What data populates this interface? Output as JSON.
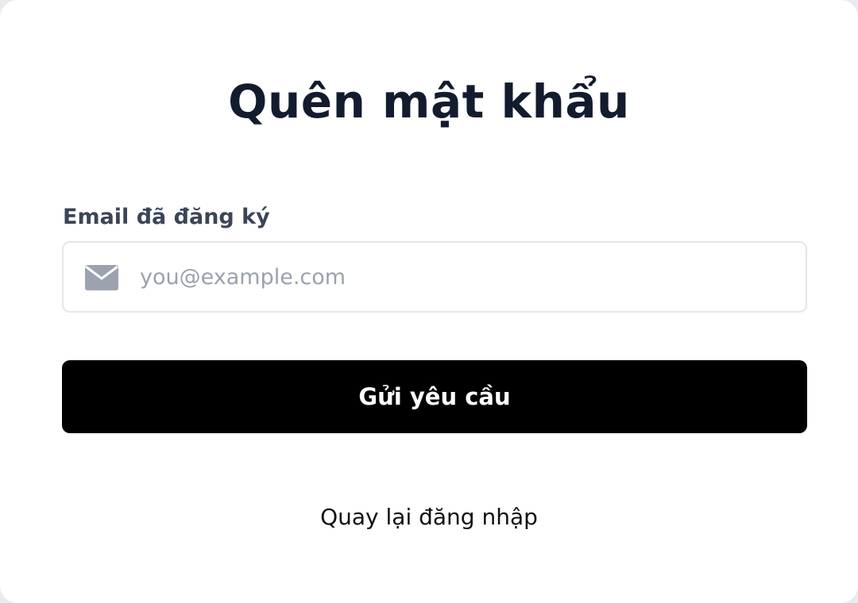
{
  "form": {
    "title": "Quên mật khẩu",
    "email_label": "Email đã đăng ký",
    "email_placeholder": "you@example.com",
    "email_value": "",
    "email_icon": "mail-icon",
    "submit_label": "Gửi yêu cầu",
    "back_link_label": "Quay lại đăng nhập"
  },
  "colors": {
    "title": "#131c2e",
    "label": "#3c4557",
    "button_bg": "#000000",
    "button_text": "#ffffff",
    "placeholder": "#9aa1ad",
    "icon": "#9ca3af",
    "field_border": "#e3e6eb"
  }
}
